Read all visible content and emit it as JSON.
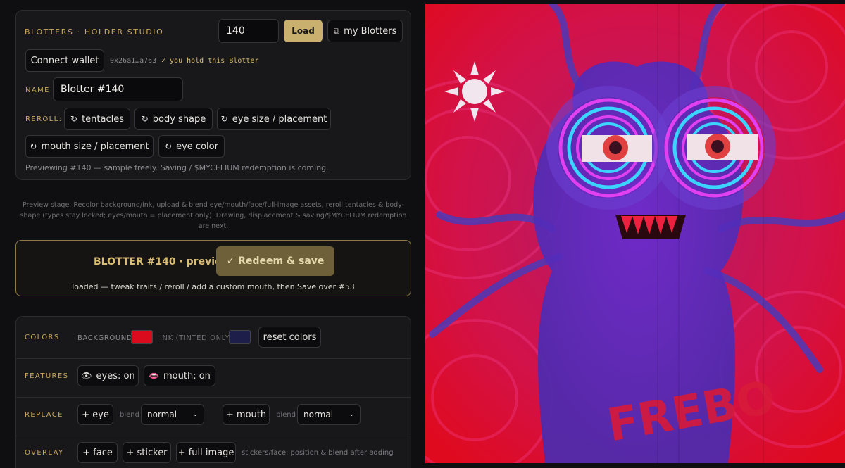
{
  "header": {
    "brand": "BLOTTERS · HOLDER STUDIO",
    "token_value": "140",
    "load_label": "Load",
    "my_blotters_label": "my Blotters"
  },
  "wallet": {
    "connect_label": "Connect wallet",
    "address": "0x26a1…a763",
    "status": "✓ you hold this Blotter"
  },
  "name": {
    "label": "NAME",
    "value": "Blotter #140"
  },
  "reroll": {
    "label": "REROLL:",
    "buttons": [
      "tentacles",
      "body shape",
      "eye size / placement",
      "mouth size / placement",
      "eye color"
    ],
    "info": "Previewing #140 — sample freely. Saving / $MYCELIUM redemption is coming."
  },
  "note": "Preview stage. Recolor background/ink, upload & blend eye/mouth/face/full-image assets, reroll tentacles & body-shape (types stay locked; eyes/mouth = placement only). Drawing, displacement & saving/$MYCELIUM redemption are next.",
  "redeem": {
    "title": "BLOTTER #140 · preview",
    "button": "✓ Redeem & save",
    "status": "loaded — tweak traits / reroll / add a custom mouth, then Save over #53"
  },
  "colors": {
    "label": "COLORS",
    "bg_label": "BACKGROUND",
    "ink_label": "INK (TINTED ONLY)",
    "reset_label": "reset colors",
    "bg_color": "#d90b1c",
    "ink_color": "#1d1f4a"
  },
  "features": {
    "label": "FEATURES",
    "eyes": "eyes: on",
    "mouth": "mouth: on"
  },
  "replace": {
    "label": "REPLACE",
    "eye": "+ eye",
    "mouth": "+ mouth",
    "blend_label": "blend",
    "eye_blend": "normal",
    "mouth_blend": "normal"
  },
  "overlay": {
    "label": "OVERLAY",
    "face": "+ face",
    "sticker": "+ sticker",
    "full_image": "+ full image",
    "hint": "stickers/face: position & blend after adding"
  },
  "art": {
    "text": "FREBO"
  }
}
